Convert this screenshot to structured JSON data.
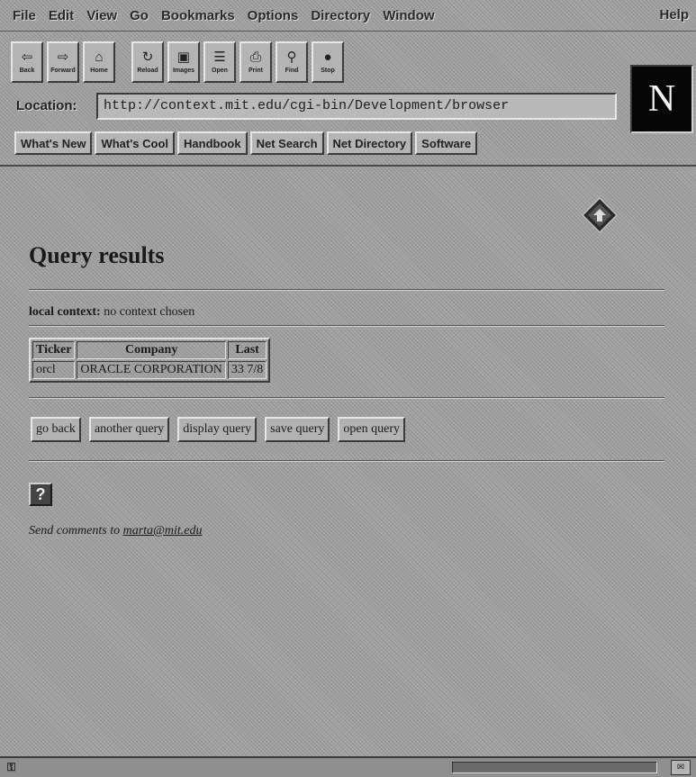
{
  "menu": {
    "items": [
      "File",
      "Edit",
      "View",
      "Go",
      "Bookmarks",
      "Options",
      "Directory",
      "Window"
    ],
    "help": "Help"
  },
  "toolbar": {
    "buttons": [
      {
        "label": "Back",
        "icon": "back-arrow-icon"
      },
      {
        "label": "Forward",
        "icon": "forward-arrow-icon"
      },
      {
        "label": "Home",
        "icon": "home-icon"
      },
      {
        "label": "Reload",
        "icon": "reload-icon"
      },
      {
        "label": "Images",
        "icon": "images-icon"
      },
      {
        "label": "Open",
        "icon": "open-icon"
      },
      {
        "label": "Print",
        "icon": "print-icon"
      },
      {
        "label": "Find",
        "icon": "find-icon"
      },
      {
        "label": "Stop",
        "icon": "stop-icon"
      }
    ]
  },
  "location": {
    "label": "Location:",
    "url": "http://context.mit.edu/cgi-bin/Development/browser"
  },
  "directory_buttons": [
    "What's New",
    "What's Cool",
    "Handbook",
    "Net Search",
    "Net Directory",
    "Software"
  ],
  "page": {
    "title": "Query results",
    "context_label": "local context:",
    "context_value": "no context chosen",
    "table": {
      "headers": [
        "Ticker",
        "Company",
        "Last"
      ],
      "rows": [
        [
          "orcl",
          "ORACLE CORPORATION",
          "33 7/8"
        ]
      ]
    },
    "buttons": [
      "go back",
      "another query",
      "display query",
      "save query",
      "open query"
    ],
    "help_icon": "?",
    "comments_prefix": "Send comments to",
    "comments_email": "marta@mit.edu"
  }
}
